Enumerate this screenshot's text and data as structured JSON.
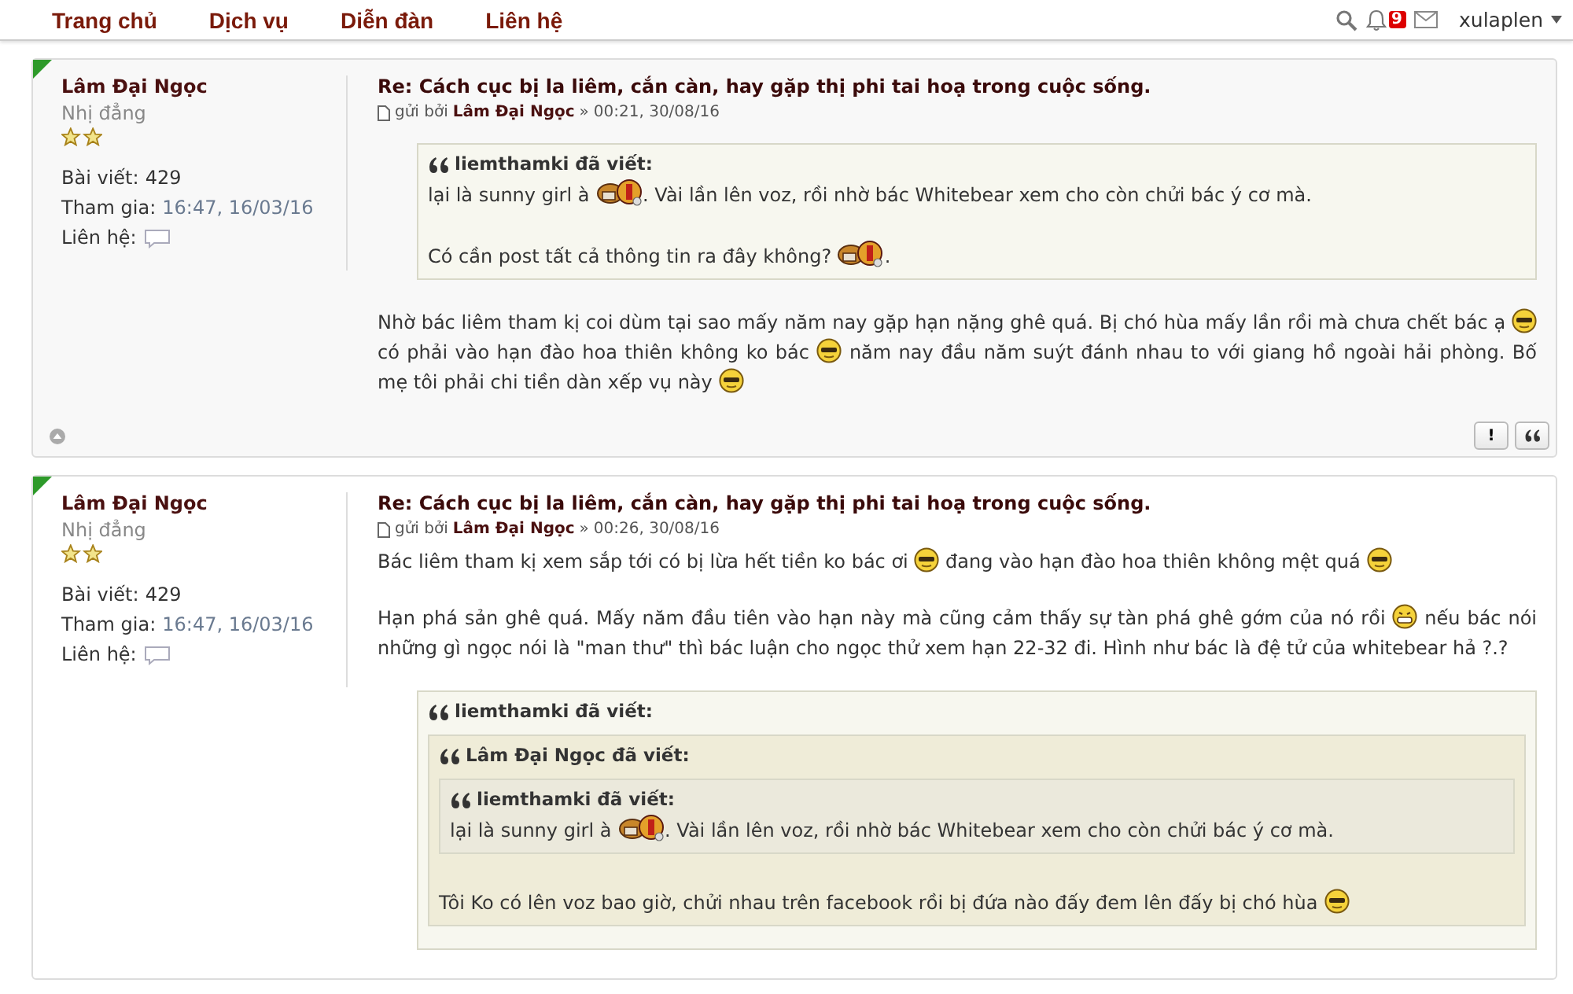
{
  "nav": {
    "items": [
      "Trang chủ",
      "Dịch vụ",
      "Diễn đàn",
      "Liên hệ"
    ],
    "notification_count": "9",
    "username": "xulaplen"
  },
  "posts": [
    {
      "author": "Lâm Đại Ngọc",
      "rank": "Nhị đẳng",
      "stats": [
        {
          "label": "Bài viết:",
          "value": "429"
        },
        {
          "label": "Tham gia:",
          "value": "16:47, 16/03/16"
        }
      ],
      "contact_label": "Liên hệ:",
      "title": "Re: Cách cục bị la liêm, cắn càn, hay gặp thị phi tai hoạ trong cuộc sống.",
      "byline": {
        "prefix": "gửi bởi",
        "author": "Lâm Đại Ngọc",
        "separator": "»",
        "time": "00:21, 30/08/16"
      },
      "blocks": [
        {
          "kind": "quote",
          "header": "liemthamki đã viết:",
          "blocks": [
            {
              "kind": "paragraph",
              "parts": [
                {
                  "kind": "text",
                  "text": "lại là sunny girl à "
                },
                {
                  "kind": "figure"
                },
                {
                  "kind": "text",
                  "text": ". Vài lần lên voz, rồi nhờ bác Whitebear xem cho còn chửi bác ý cơ mà."
                }
              ]
            },
            {
              "kind": "paragraph",
              "parts": [
                {
                  "kind": "text",
                  "text": "Có cần post tất cả thông tin ra đây không? "
                },
                {
                  "kind": "figure"
                },
                {
                  "kind": "text",
                  "text": "."
                }
              ]
            }
          ]
        },
        {
          "kind": "paragraph",
          "parts": [
            {
              "kind": "text",
              "text": "Nhờ bác liêm tham kị coi dùm tại sao mấy năm nay gặp hạn nặng ghê quá. Bị chó hùa mấy lần rồi mà chưa chết bác ạ "
            },
            {
              "kind": "cool"
            },
            {
              "kind": "text",
              "text": " có phải vào hạn đào hoa thiên không ko bác "
            },
            {
              "kind": "cool"
            },
            {
              "kind": "text",
              "text": " năm nay đầu năm suýt đánh nhau to với giang hồ ngoài hải phòng. Bố mẹ tôi phải chi tiền dàn xếp vụ này "
            },
            {
              "kind": "cool"
            }
          ]
        }
      ],
      "actions": [
        {
          "kind": "report",
          "label": "!"
        },
        {
          "kind": "quote"
        }
      ]
    },
    {
      "author": "Lâm Đại Ngọc",
      "rank": "Nhị đẳng",
      "stats": [
        {
          "label": "Bài viết:",
          "value": "429"
        },
        {
          "label": "Tham gia:",
          "value": "16:47, 16/03/16"
        }
      ],
      "contact_label": "Liên hệ:",
      "title": "Re: Cách cục bị la liêm, cắn càn, hay gặp thị phi tai hoạ trong cuộc sống.",
      "byline": {
        "prefix": "gửi bởi",
        "author": "Lâm Đại Ngọc",
        "separator": "»",
        "time": "00:26, 30/08/16"
      },
      "blocks": [
        {
          "kind": "paragraph",
          "parts": [
            {
              "kind": "text",
              "text": "Bác liêm tham kị xem sắp tới có bị lừa hết tiền ko bác ơi "
            },
            {
              "kind": "cool"
            },
            {
              "kind": "text",
              "text": " đang vào hạn đào hoa thiên không mệt quá "
            },
            {
              "kind": "cool"
            }
          ]
        },
        {
          "kind": "paragraph",
          "parts": [
            {
              "kind": "text",
              "text": "Hạn phá sản ghê quá. Mấy năm đầu tiên vào hạn này mà cũng cảm thấy sự tàn phá ghê gớm của nó rồi "
            },
            {
              "kind": "grin"
            },
            {
              "kind": "text",
              "text": " nếu bác nói những gì ngọc nói là \"man thư\" thì bác luận cho ngọc thử xem hạn 22-32 đi. Hình như bác là đệ tử của whitebear hả ?.?"
            }
          ]
        },
        {
          "kind": "quote",
          "header": "liemthamki đã viết:",
          "blocks": [
            {
              "kind": "quote",
              "header": "Lâm Đại Ngọc đã viết:",
              "blocks": [
                {
                  "kind": "quote",
                  "header": "liemthamki đã viết:",
                  "blocks": [
                    {
                      "kind": "paragraph",
                      "parts": [
                        {
                          "kind": "text",
                          "text": "lại là sunny girl à "
                        },
                        {
                          "kind": "figure"
                        },
                        {
                          "kind": "text",
                          "text": ". Vài lần lên voz, rồi nhờ bác Whitebear xem cho còn chửi bác ý cơ mà."
                        }
                      ]
                    }
                  ]
                },
                {
                  "kind": "paragraph",
                  "parts": [
                    {
                      "kind": "text",
                      "text": "Tôi Ko có lên voz bao giờ, chửi nhau trên facebook rồi bị đứa nào đấy đem lên đấy bị chó hùa "
                    },
                    {
                      "kind": "cool"
                    }
                  ]
                }
              ]
            }
          ]
        }
      ]
    }
  ]
}
